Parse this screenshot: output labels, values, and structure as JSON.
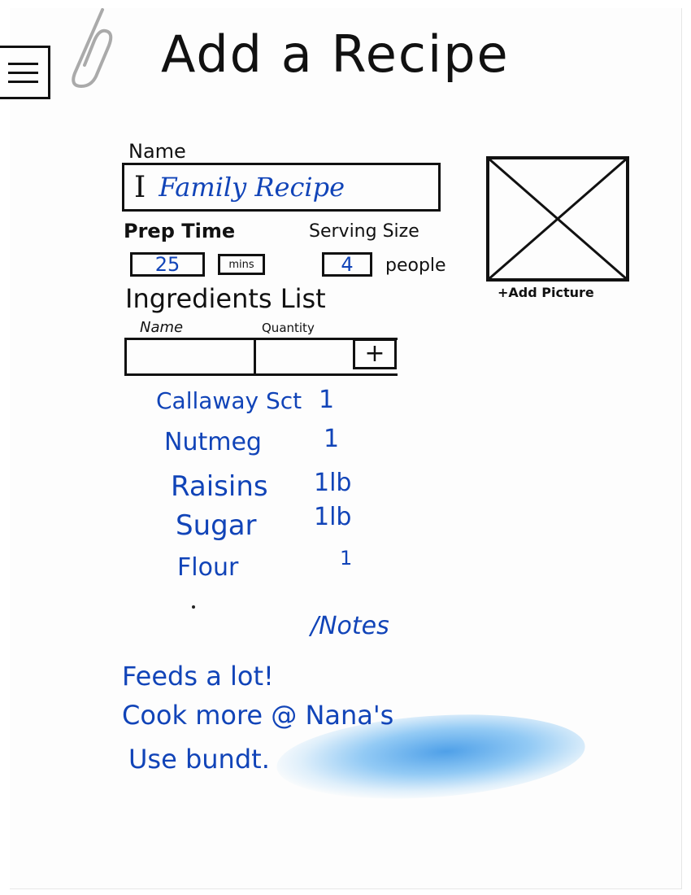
{
  "title": "Add a Recipe",
  "menu_icon": "hamburger-menu-icon",
  "name_field": {
    "label": "Name",
    "cursor": "I",
    "value": "Family Recipe"
  },
  "prep_time": {
    "label": "Prep Time",
    "value": "25",
    "unit": "mins"
  },
  "serving_size": {
    "label": "Serving Size",
    "value": "4",
    "unit": "people"
  },
  "picture": {
    "icon": "image-placeholder-icon",
    "add_label": "+Add Picture"
  },
  "ingredients": {
    "heading": "Ingredients List",
    "col_name": "Name",
    "col_quantity": "Quantity",
    "add_button": "+",
    "items": [
      {
        "name": "Callaway Sct",
        "qty": "1"
      },
      {
        "name": "Nutmeg",
        "qty": "1"
      },
      {
        "name": "Raisins",
        "qty": "1lb"
      },
      {
        "name": "Sugar",
        "qty": "1lb"
      },
      {
        "name": "Flour",
        "qty": "1"
      }
    ]
  },
  "notes": {
    "heading": "/Notes",
    "lines": [
      "Feeds a lot!",
      "Cook more @ Nana's",
      "Use bundt."
    ]
  },
  "colors": {
    "ink": "#111111",
    "blue_ink": "#1144b8",
    "smudge": "#3c96e6"
  }
}
